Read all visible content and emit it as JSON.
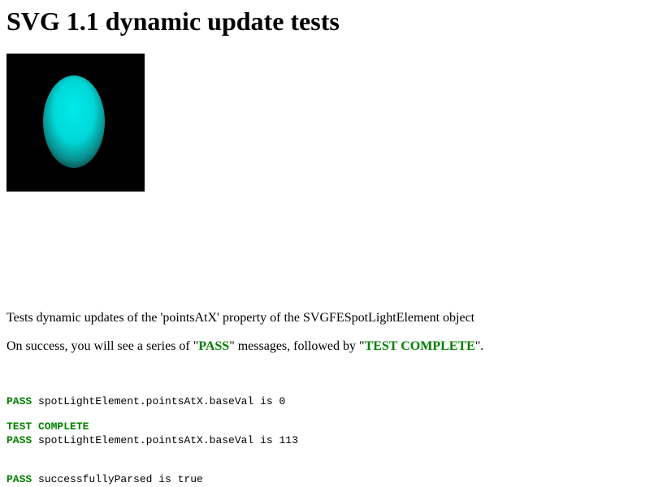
{
  "page": {
    "title": "SVG 1.1 dynamic update tests"
  },
  "figure": {
    "background_color": "#000000",
    "ellipse_color": "#00e5e5",
    "ellipse_edge_color": "#0a4a4a"
  },
  "description": {
    "line1": "Tests dynamic updates of the 'pointsAtX' property of the SVGFESpotLightElement object",
    "line2_prefix": "On success, you will see a series of \"",
    "line2_pass": "PASS",
    "line2_middle": "\" messages, followed by \"",
    "line2_complete": "TEST COMPLETE",
    "line2_suffix": "\"."
  },
  "console": {
    "lines": [
      {
        "status": "PASS",
        "message": " spotLightElement.pointsAtX.baseVal is 0"
      },
      {
        "status": "PASS",
        "message": " spotLightElement.pointsAtX.baseVal is 113"
      },
      {
        "status": "PASS",
        "message": " successfullyParsed is true"
      }
    ],
    "complete": "TEST COMPLETE"
  }
}
